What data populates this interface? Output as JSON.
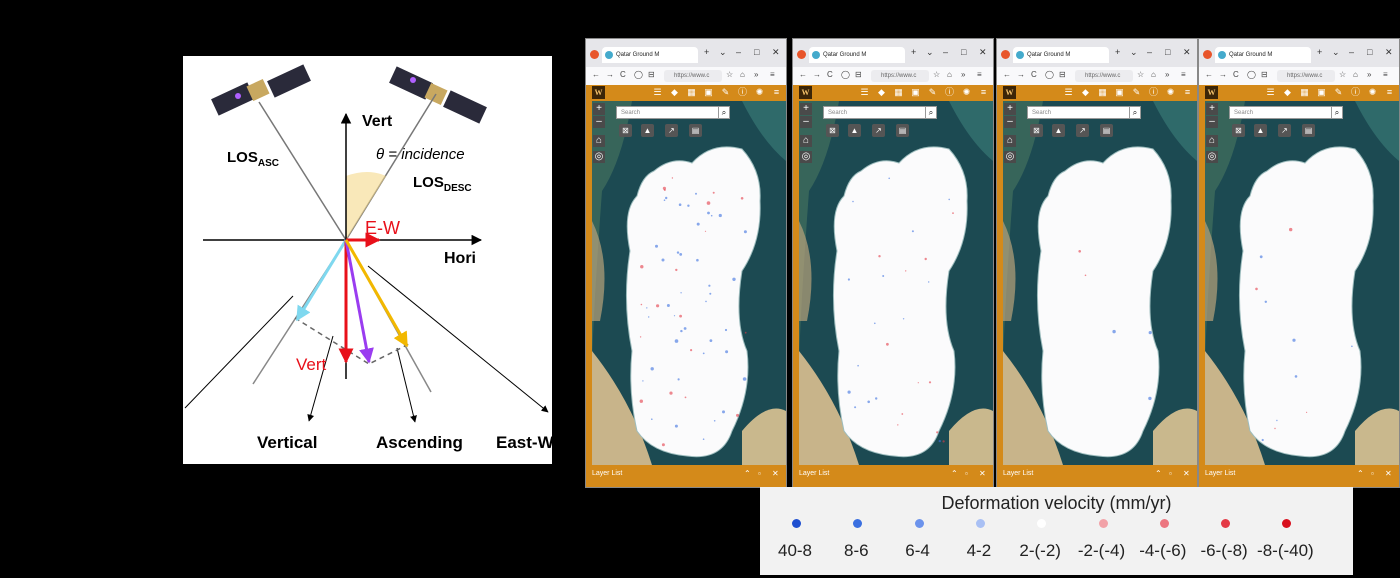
{
  "diagram": {
    "los_asc": "LOS",
    "los_asc_sub": "ASC",
    "los_desc": "LOS",
    "los_desc_sub": "DESC",
    "vert_axis": "Vert",
    "hori_axis": "Hori",
    "incidence": "θ = incidence",
    "ew_label": "E-W",
    "vert_label": "Vert",
    "bottom_labels": [
      "Vertical",
      "Ascending",
      "East-West"
    ]
  },
  "browser": {
    "tab_title": "Qatar Ground M",
    "url": "https://www.c",
    "search_placeholder": "Search",
    "layer_list_label": "Layer List",
    "logo": "W",
    "windows": [
      "window-1",
      "window-2",
      "window-3",
      "window-4"
    ]
  },
  "legend": {
    "title": "Deformation velocity (mm/yr)",
    "items": [
      {
        "label": "40-8",
        "color": "#1f4fd0"
      },
      {
        "label": "8-6",
        "color": "#3a6fe0"
      },
      {
        "label": "6-4",
        "color": "#6c93ec"
      },
      {
        "label": "4-2",
        "color": "#a9c0f4"
      },
      {
        "label": "2-(-2)",
        "color": "#ffffff"
      },
      {
        "label": "-2-(-4)",
        "color": "#f2a2a8"
      },
      {
        "label": "-4-(-6)",
        "color": "#ec7680"
      },
      {
        "label": "-6-(-8)",
        "color": "#e43a46"
      },
      {
        "label": "-8-(-40)",
        "color": "#d8101e"
      }
    ]
  }
}
